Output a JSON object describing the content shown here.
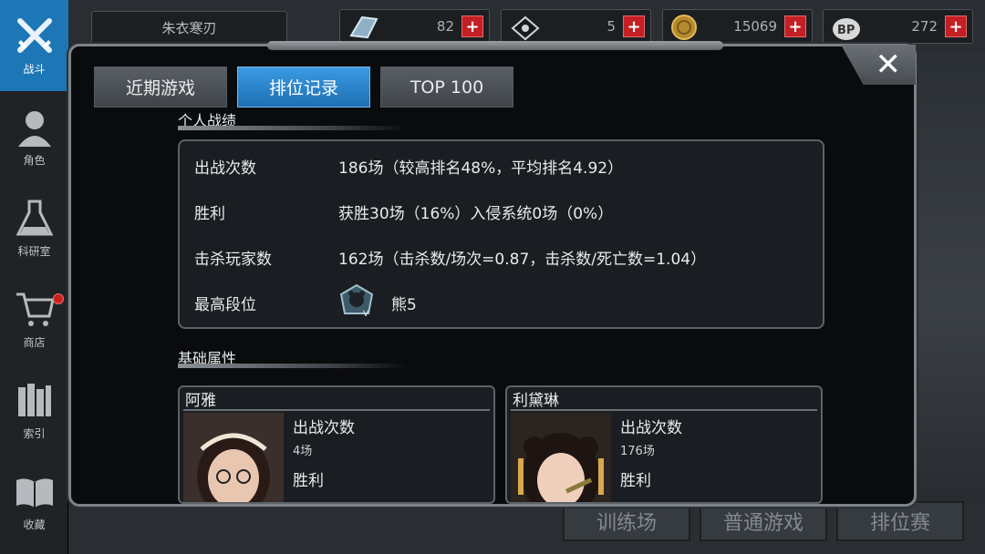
{
  "sidebar": {
    "items": [
      {
        "label": "战斗",
        "icon": "crossed-swords-icon"
      },
      {
        "label": "角色",
        "icon": "character-icon"
      },
      {
        "label": "科研室",
        "icon": "flask-icon"
      },
      {
        "label": "商店",
        "icon": "cart-icon"
      },
      {
        "label": "索引",
        "icon": "books-icon"
      },
      {
        "label": "收藏",
        "icon": "open-book-icon"
      }
    ]
  },
  "header": {
    "player_name": "朱衣寒刃",
    "resources": [
      {
        "icon": "crystal-icon",
        "value": "82"
      },
      {
        "icon": "ticket-icon",
        "value": "5"
      },
      {
        "icon": "coin-icon",
        "value": "15069"
      },
      {
        "icon": "bp-icon",
        "value": "272"
      }
    ]
  },
  "background_buttons": [
    "训练场",
    "普通游戏",
    "排位赛"
  ],
  "modal": {
    "tabs": [
      {
        "label": "近期游戏",
        "active": false
      },
      {
        "label": "排位记录",
        "active": true
      },
      {
        "label": "TOP 100",
        "active": false
      }
    ],
    "personal_section_title": "个人战绩",
    "stats": [
      {
        "label": "出战次数",
        "value": "186场（较高排名48%，平均排名4.92）"
      },
      {
        "label": "胜利",
        "value": "获胜30场（16%）入侵系统0场（0%）"
      },
      {
        "label": "击杀玩家数",
        "value": "162场（击杀数/场次=0.87，击杀数/死亡数=1.04）"
      },
      {
        "label": "最高段位",
        "value": "熊5",
        "icon": "bear-rank-badge-icon"
      }
    ],
    "basic_section_title": "基础属性",
    "characters": [
      {
        "name": "阿雅",
        "label1": "出战次数",
        "value1": "4场",
        "label2": "胜利"
      },
      {
        "name": "利黛琳",
        "label1": "出战次数",
        "value1": "176场",
        "label2": "胜利"
      }
    ]
  },
  "colors": {
    "accent": "#1d77b6",
    "plus": "#c41f24",
    "active_tab": "#2a86d0"
  }
}
